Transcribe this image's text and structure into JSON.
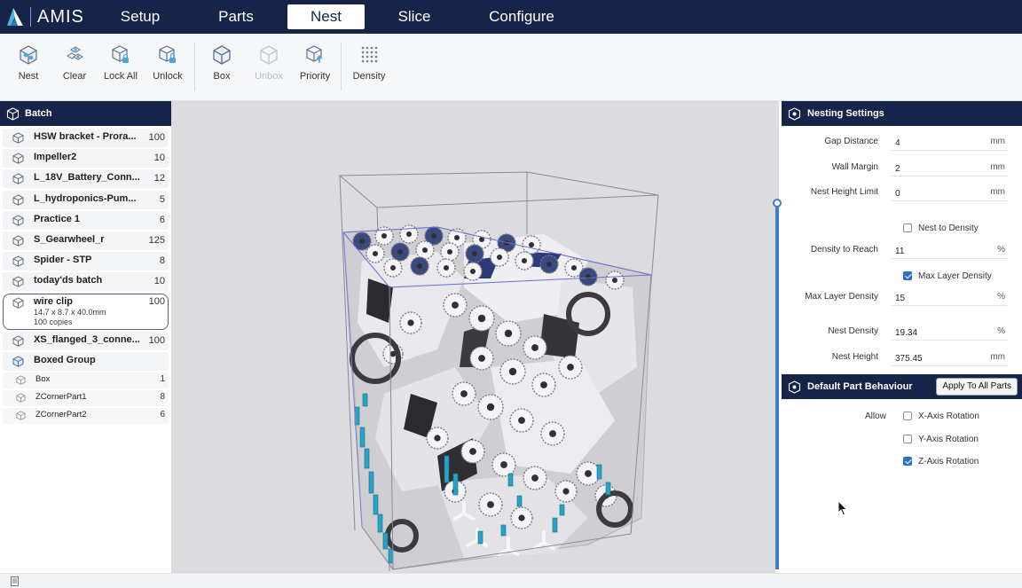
{
  "app": {
    "name": "AMIS"
  },
  "nav": [
    {
      "label": "Setup",
      "active": false
    },
    {
      "label": "Parts",
      "active": false
    },
    {
      "label": "Nest",
      "active": true
    },
    {
      "label": "Slice",
      "active": false
    },
    {
      "label": "Configure",
      "active": false
    }
  ],
  "toolbar": {
    "items": [
      {
        "label": "Nest",
        "icon": "nest-cube-icon",
        "enabled": true
      },
      {
        "label": "Clear",
        "icon": "clear-cubes-icon",
        "enabled": true
      },
      {
        "label": "Lock All",
        "icon": "lock-all-icon",
        "enabled": true
      },
      {
        "label": "Unlock",
        "icon": "unlock-icon",
        "enabled": true
      },
      {
        "label": "Box",
        "icon": "box-icon",
        "enabled": true
      },
      {
        "label": "Unbox",
        "icon": "unbox-icon",
        "enabled": false
      },
      {
        "label": "Priority",
        "icon": "priority-icon",
        "enabled": true
      },
      {
        "label": "Density",
        "icon": "density-grid-icon",
        "enabled": true
      }
    ]
  },
  "batch": {
    "title": "Batch",
    "parts": [
      {
        "name": "HSW bracket - Prora...",
        "count": "100"
      },
      {
        "name": "Impeller2",
        "count": "10"
      },
      {
        "name": "L_18V_Battery_Conn...",
        "count": "12"
      },
      {
        "name": "L_hydroponics-Pum...",
        "count": "5"
      },
      {
        "name": "Practice 1",
        "count": "6"
      },
      {
        "name": "S_Gearwheel_r",
        "count": "125"
      },
      {
        "name": "Spider - STP",
        "count": "8"
      },
      {
        "name": "today'ds batch",
        "count": "10"
      }
    ],
    "selected": {
      "name": "wire clip",
      "count": "100",
      "dims": "14.7 x 8.7 x 40.0mm",
      "copies": "100 copies"
    },
    "after": [
      {
        "name": "XS_flanged_3_conne...",
        "count": "100"
      }
    ],
    "group": {
      "name": "Boxed Group",
      "children": [
        {
          "name": "Box",
          "count": "1"
        },
        {
          "name": "ZCornerPart1",
          "count": "8"
        },
        {
          "name": "ZCornerPart2",
          "count": "6"
        }
      ]
    }
  },
  "nesting": {
    "title": "Nesting Settings",
    "gap_distance": {
      "label": "Gap Distance",
      "value": "4",
      "unit": "mm"
    },
    "wall_margin": {
      "label": "Wall Margin",
      "value": "2",
      "unit": "mm"
    },
    "nest_height_limit": {
      "label": "Nest Height Limit",
      "value": "0",
      "unit": "mm"
    },
    "nest_to_density": {
      "label": "Nest to Density",
      "checked": false
    },
    "density_to_reach": {
      "label": "Density to Reach",
      "value": "11",
      "unit": "%"
    },
    "max_layer_density_check": {
      "label": "Max Layer Density",
      "checked": true
    },
    "max_layer_density": {
      "label": "Max Layer Density",
      "value": "15",
      "unit": "%"
    },
    "nest_density": {
      "label": "Nest Density",
      "value": "19.34",
      "unit": "%"
    },
    "nest_height": {
      "label": "Nest Height",
      "value": "375.45",
      "unit": "mm"
    }
  },
  "behaviour": {
    "title": "Default Part Behaviour",
    "apply_label": "Apply To All Parts",
    "allow_label": "Allow",
    "x_rot": {
      "label": "X-Axis Rotation",
      "checked": false
    },
    "y_rot": {
      "label": "Y-Axis Rotation",
      "checked": false
    },
    "z_rot": {
      "label": "Z-Axis Rotation",
      "checked": true
    }
  },
  "colors": {
    "header": "#16244a",
    "accent": "#2d6fc7",
    "part_cyan": "#27a3c4",
    "viewport_bg": "#dcdcdf"
  }
}
